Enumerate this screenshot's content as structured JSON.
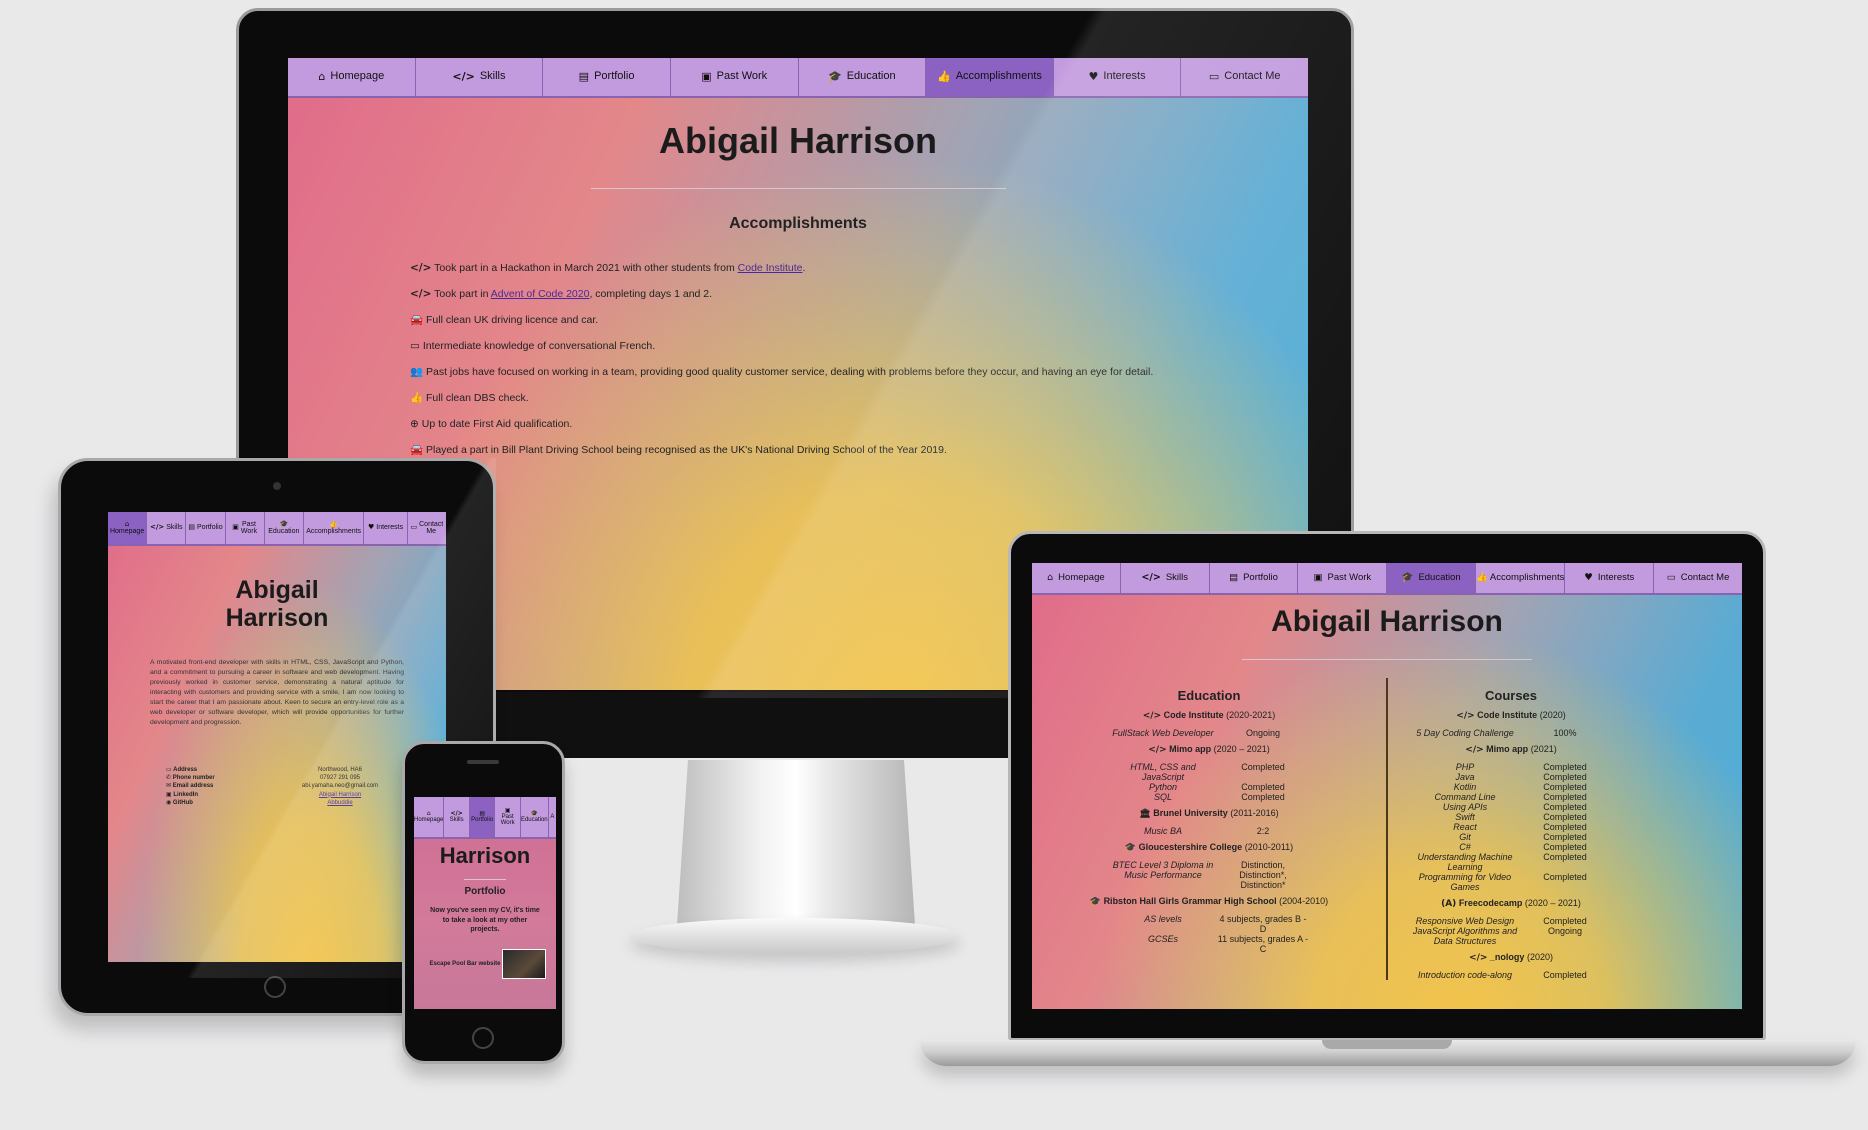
{
  "nav": [
    {
      "icon": "⌂",
      "label": "Homepage",
      "name": "home-icon"
    },
    {
      "icon": "</>",
      "label": "Skills",
      "name": "code-icon"
    },
    {
      "icon": "▤",
      "label": "Portfolio",
      "name": "book-icon"
    },
    {
      "icon": "▣",
      "label": "Past Work",
      "name": "briefcase-icon"
    },
    {
      "icon": "🎓",
      "label": "Education",
      "name": "graduation-cap-icon"
    },
    {
      "icon": "👍",
      "label": "Accomplishments",
      "name": "thumbs-up-icon"
    },
    {
      "icon": "♥",
      "label": "Interests",
      "name": "heart-icon"
    },
    {
      "icon": "▭",
      "label": "Contact Me",
      "name": "address-card-icon"
    }
  ],
  "tablet_nav": {
    "past_work": [
      "Past",
      "Work"
    ],
    "contact_me": [
      "Contact",
      "Me"
    ]
  },
  "phone_nav": {
    "homepage": "Homepage",
    "skills": "Skills",
    "portfolio": "Portfolio",
    "past_work": [
      "Past",
      "Work"
    ],
    "education": "Education",
    "accomplishments_cut": "A"
  },
  "name": "Abigail Harrison",
  "name_parts": [
    "Abigail",
    "Harrison"
  ],
  "desktop": {
    "section_title": "Accomplishments",
    "items": [
      {
        "icon": "</>",
        "parts": [
          "Took part in a Hackathon in March 2021 with other students from ",
          "Code Institute",
          "."
        ]
      },
      {
        "icon": "</>",
        "parts": [
          "Took part in ",
          "Advent of Code 2020",
          ", completing days 1 and 2."
        ]
      },
      {
        "icon": "🚘",
        "text": "Full clean UK driving licence and car."
      },
      {
        "icon": "▭",
        "text": "Intermediate knowledge of conversational French."
      },
      {
        "icon": "👥",
        "text": "Past jobs have focused on working in a team, providing good quality customer service, dealing with problems before they occur, and having an eye for detail."
      },
      {
        "icon": "👍",
        "text": "Full clean DBS check."
      },
      {
        "icon": "⊕",
        "text": "Up to date First Aid qualification."
      },
      {
        "icon": "🚘",
        "text": "Played a part in Bill Plant Driving School being recognised as the UK's National Driving School of the Year 2019."
      }
    ]
  },
  "tablet": {
    "bio": "A motivated front-end developer with skills in HTML, CSS, JavaScript and Python, and a commitment to pursuing a career in software and web development. Having previously worked in customer service, demonstrating a natural aptitude for interacting with customers and providing service with a smile, I am now looking to start the career that I am passionate about. Keen to secure an entry-level role as a web developer or software developer, which will provide opportunities for further development and progression.",
    "contact": [
      {
        "icon": "▭",
        "label": "Address",
        "value": "Northwood, HA6",
        "link": false
      },
      {
        "icon": "✆",
        "label": "Phone number",
        "value": "07927 291 095",
        "link": false
      },
      {
        "icon": "✉",
        "label": "Email address",
        "value": "abi.yamaha.neo@gmail.com",
        "link": false
      },
      {
        "icon": "▣",
        "label": "LinkedIn",
        "value": "Abigail Harrison",
        "link": true
      },
      {
        "icon": "◉",
        "label": "GitHub",
        "value": "Abbuddie",
        "link": true
      }
    ]
  },
  "phone": {
    "name": "Harrison",
    "section_title": "Portfolio",
    "intro": "Now you've seen my CV, it's time to take a look at my other projects.",
    "project": "Escape Pool Bar website"
  },
  "laptop": {
    "education_title": "Education",
    "courses_title": "Courses",
    "education": [
      {
        "icon": "</>",
        "school": "Code Institute",
        "years": "(2020-2021)",
        "rows": [
          [
            "FullStack Web Developer",
            "Ongoing"
          ]
        ]
      },
      {
        "icon": "</>",
        "school": "Mimo app",
        "years": "(2020 – 2021)",
        "rows": [
          [
            "HTML, CSS and JavaScript",
            "Completed"
          ],
          [
            "Python",
            "Completed"
          ],
          [
            "SQL",
            "Completed"
          ]
        ]
      },
      {
        "icon": "🏛",
        "school": "Brunel University",
        "years": "(2011-2016)",
        "rows": [
          [
            "Music BA",
            "2:2"
          ]
        ]
      },
      {
        "icon": "🎓",
        "school": "Gloucestershire College",
        "years": "(2010-2011)",
        "rows": [
          [
            "BTEC Level 3 Diploma in Music Performance",
            "Distinction, Distinction*, Distinction*"
          ]
        ]
      },
      {
        "icon": "🎓",
        "school": "Ribston Hall Girls Grammar High School",
        "years": "(2004-2010)",
        "rows": [
          [
            "AS levels",
            "4 subjects, grades B - D"
          ],
          [
            "GCSEs",
            "11 subjects, grades A - C"
          ]
        ]
      }
    ],
    "courses": [
      {
        "icon": "</>",
        "school": "Code Institute",
        "years": "(2020)",
        "rows": [
          [
            "5 Day Coding Challenge",
            "100%"
          ]
        ]
      },
      {
        "icon": "</>",
        "school": "Mimo app",
        "years": "(2021)",
        "rows": [
          [
            "PHP",
            "Completed"
          ],
          [
            "Java",
            "Completed"
          ],
          [
            "Kotlin",
            "Completed"
          ],
          [
            "Command Line",
            "Completed"
          ],
          [
            "Using APIs",
            "Completed"
          ],
          [
            "Swift",
            "Completed"
          ],
          [
            "React",
            "Completed"
          ],
          [
            "Git",
            "Completed"
          ],
          [
            "C#",
            "Completed"
          ],
          [
            "Understanding Machine Learning",
            "Completed"
          ],
          [
            "Programming for Video Games",
            "Completed"
          ]
        ]
      },
      {
        "icon": "(A)",
        "school": "Freecodecamp",
        "years": "(2020 – 2021)",
        "rows": [
          [
            "Responsive Web Design",
            "Completed"
          ],
          [
            "JavaScript Algorithms and Data Structures",
            "Ongoing"
          ]
        ]
      },
      {
        "icon": "</>",
        "school": "_nology",
        "years": "(2020)",
        "rows": [
          [
            "Introduction code-along",
            "Completed"
          ]
        ]
      }
    ]
  },
  "colors": {
    "nav_bg": "#c29ade",
    "nav_active": "#8b61c2",
    "gradient_pink": "#e06b8a",
    "gradient_blue": "#4eaed6",
    "gradient_yellow": "#f4c44a"
  }
}
